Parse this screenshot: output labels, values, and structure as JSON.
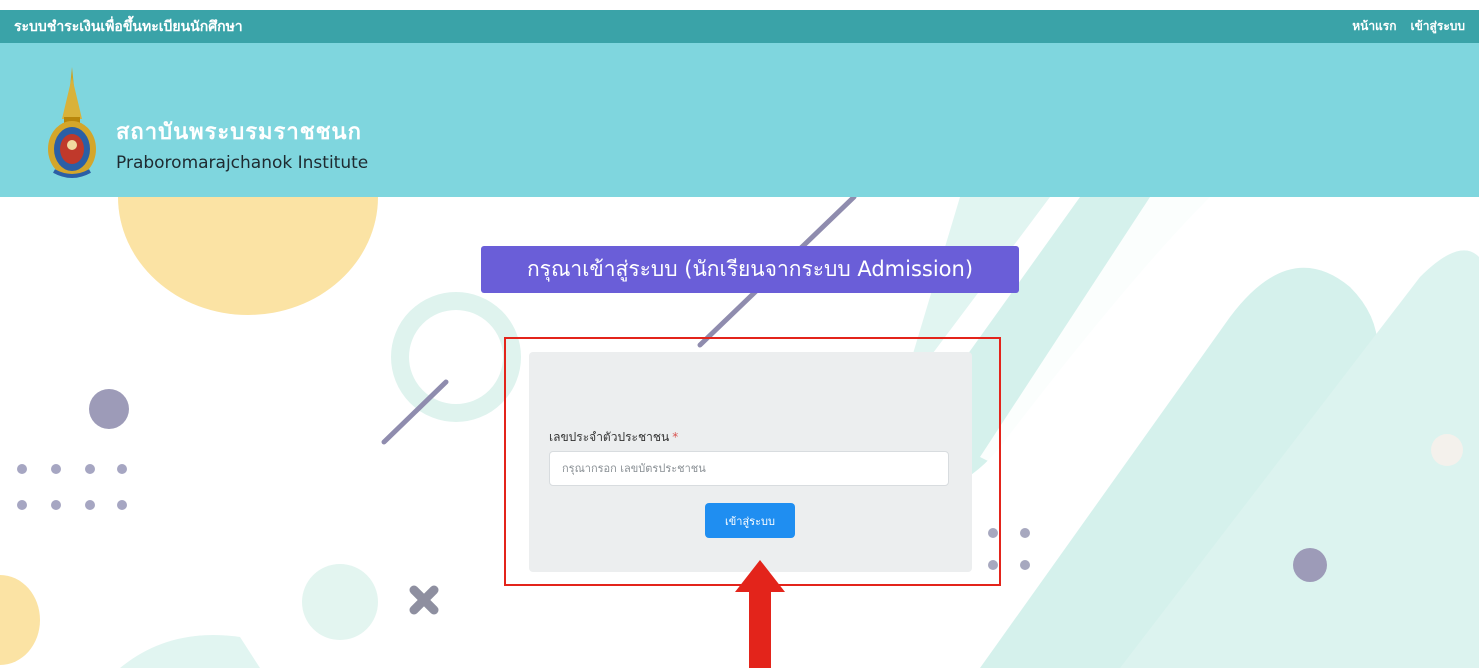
{
  "topbar": {
    "app_title": "ระบบชำระเงินเพื่อขึ้นทะเบียนนักศึกษา",
    "nav": {
      "home": "หน้าแรก",
      "login": "เข้าสู่ระบบ"
    }
  },
  "header": {
    "org_name_th": "สถาบันพระบรมราชชนก",
    "org_name_en": "Praboromarajchanok Institute",
    "logo_icon": "institute-emblem-icon"
  },
  "main": {
    "heading": "กรุณาเข้าสู่ระบบ (นักเรียนจากระบบ Admission)",
    "form": {
      "id_label": "เลขประจำตัวประชาชน",
      "required_mark": "*",
      "id_placeholder": "กรุณากรอก เลขบัตรประชาชน",
      "id_value": "",
      "submit_label": "เข้าสู่ระบบ"
    }
  },
  "colors": {
    "topbar": "#3aa3a8",
    "banner": "#7fd6de",
    "heading_bg": "#6a5ed8",
    "button": "#1f8ef1",
    "annotation": "#e3241b"
  }
}
